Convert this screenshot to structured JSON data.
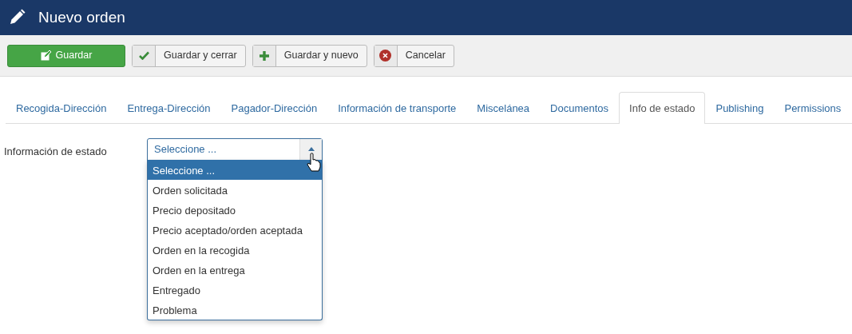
{
  "header": {
    "title": "Nuevo orden"
  },
  "toolbar": [
    {
      "label": "Guardar",
      "kind": "save"
    },
    {
      "label": "Guardar y cerrar",
      "kind": "check"
    },
    {
      "label": "Guardar y nuevo",
      "kind": "plus"
    },
    {
      "label": "Cancelar",
      "kind": "cancel"
    }
  ],
  "tabs": [
    {
      "label": "Recogida-Dirección",
      "selected": false
    },
    {
      "label": "Entrega-Dirección",
      "selected": false
    },
    {
      "label": "Pagador-Dirección",
      "selected": false
    },
    {
      "label": "Información de transporte",
      "selected": false
    },
    {
      "label": "Miscelánea",
      "selected": false
    },
    {
      "label": "Documentos",
      "selected": false
    },
    {
      "label": "Info de estado",
      "selected": true
    },
    {
      "label": "Publishing",
      "selected": false
    },
    {
      "label": "Permissions",
      "selected": false
    }
  ],
  "field": {
    "label": "Información de estado",
    "value": "Seleccione ...",
    "expanded": true,
    "options": [
      {
        "label": "Seleccione ...",
        "selected": true
      },
      {
        "label": "Orden solicitada",
        "selected": false
      },
      {
        "label": "Precio depositado",
        "selected": false
      },
      {
        "label": "Precio aceptado/orden aceptada",
        "selected": false
      },
      {
        "label": "Orden en la recogida",
        "selected": false
      },
      {
        "label": "Orden en la entrega",
        "selected": false
      },
      {
        "label": "Entregado",
        "selected": false
      },
      {
        "label": "Problema",
        "selected": false
      }
    ]
  }
}
